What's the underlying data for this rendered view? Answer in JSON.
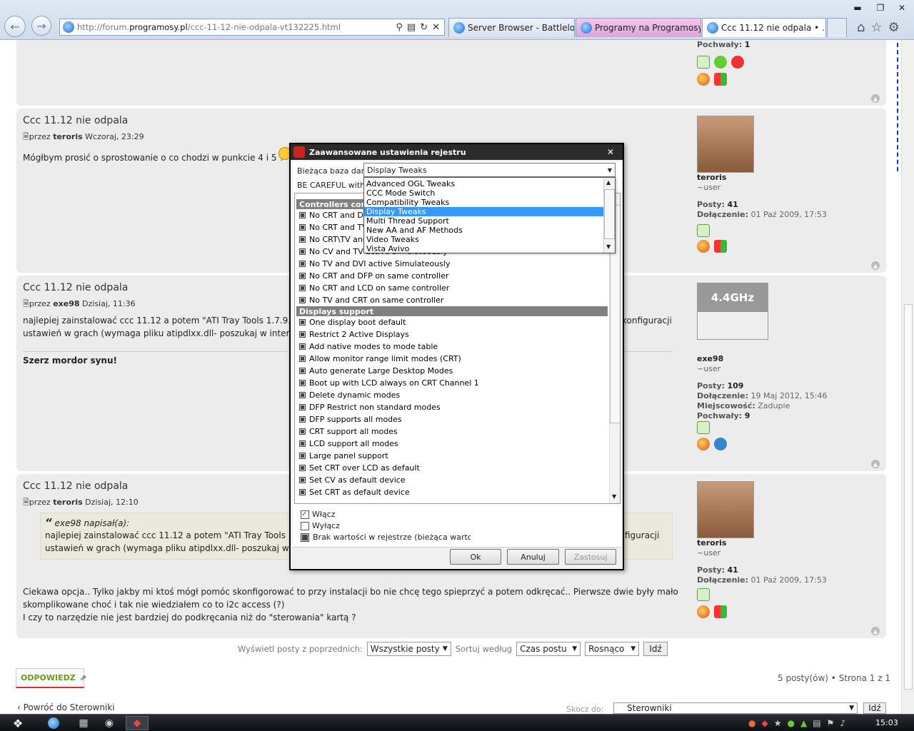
{
  "browser": {
    "address_prefix": "http://forum.",
    "address_domain": "programosy.pl",
    "address_suffix": "/ccc-11-12-nie-odpala-vt132225.html",
    "tabs": [
      {
        "label": "Server Browser - Battlelog ..."
      },
      {
        "label": "Programy na Programosy...."
      },
      {
        "label": "Ccc 11.12 nie odpala • ..."
      }
    ]
  },
  "top_profile": {
    "label": "Pochwały:",
    "value": "1"
  },
  "posts": [
    {
      "title": "Ccc 11.12 nie odpala",
      "meta_by": "przez",
      "author": "teroris",
      "time": "Wczoraj, 23:29",
      "text": "Mógłbym prosić o sprostowanie o co chodzi w punkcie 4 i 5 ?",
      "profile": {
        "name": "teroris",
        "rank": "~user",
        "posts_label": "Posty:",
        "posts": "41",
        "joined_label": "Dołączenie:",
        "joined": "01 Paź 2009, 17:53"
      }
    },
    {
      "title": "Ccc 11.12 nie odpala",
      "meta_by": "przez",
      "author": "exe98",
      "time": "Dzisiaj, 11:36",
      "text1": "najlepiej zainstalować ccc 11.12 a potem \"ATI Tray Tools 1.7.9.",
      "text1_end": "konfiguracji",
      "text2": "ustawień w grach (wymaga pliku atipdlxx.dll- poszukaj w intern",
      "signature": "Szerz mordor synu!",
      "avatar_text": "4.4GHz",
      "profile": {
        "name": "exe98",
        "rank": "~user",
        "posts_label": "Posty:",
        "posts": "109",
        "joined_label": "Dołączenie:",
        "joined": "19 Maj 2012, 15:46",
        "location_label": "Miejscowość:",
        "location": "Zadupie",
        "praise_label": "Pochwały:",
        "praise": "9"
      }
    },
    {
      "title": "Ccc 11.12 nie odpala",
      "meta_by": "przez",
      "author": "teroris",
      "time": "Dzisiaj, 12:10",
      "quote_author": "exe98 napisał(a):",
      "quote1": "najlepiej zainstalować ccc 11.12 a potem \"ATI Tray Tools 1.7.9",
      "quote1_end": "figuracji",
      "quote2": "ustawień w grach (wymaga pliku atipdlxx.dll- poszukaj w inter",
      "text1": "Ciekawa opcja.. Tylko jakby mi ktoś mógł pomóc skonfigorować to przy instalacji bo nie chcę tego spieprzyć a potem odkręcać.. Pierwsze dwie były mało",
      "text2": "skomplikowane choć i tak nie wiedziałem co to i2c access (?)",
      "text3": "I czy to narzędzie nie jest bardziej do podkręcania niż do \"sterowania\" kartą ?",
      "profile": {
        "name": "teroris",
        "rank": "~user",
        "posts_label": "Posty:",
        "posts": "41",
        "joined_label": "Dołączenie:",
        "joined": "01 Paź 2009, 17:53"
      }
    }
  ],
  "sortbar": {
    "show_label": "Wyświetl posty z poprzednich:",
    "show_value": "Wszystkie posty",
    "sort_label": "Sortuj według",
    "sort_value": "Czas postu",
    "order_value": "Rosnąco",
    "go": "Idź"
  },
  "footer": {
    "reply": "ODPOWIEDZ",
    "count": "5 posty(ów) • Strona 1 z 1",
    "back": "Powróć do Sterowniki",
    "jump_label": "Skocz do:",
    "jump_value": "Sterowniki",
    "go": "Idź"
  },
  "dialog": {
    "title": "Zaawansowane ustawienia rejestru",
    "db_label": "Bieżąca baza danyc",
    "db_value": "Display Tweaks",
    "warning": "BE CAREFUL with t",
    "dropdown": [
      "Advanced OGL Tweaks",
      "CCC Mode Switch",
      "Compatibility Tweaks",
      "Display Tweaks",
      "Multi Thread Support",
      "New AA and AF Methods",
      "Video Tweaks",
      "Vista Avivo"
    ],
    "group1": "Controllers confi",
    "group1_items": [
      "No CRT and DFP",
      "No CRT and TV a",
      "No CRT\\TV and D",
      "No CV and TV active Simulateously",
      "No TV and DVI active Simulateously",
      "No CRT and DFP on same controller",
      "No CRT and LCD on same controller",
      "No TV and CRT on same controller"
    ],
    "group2": "Displays support",
    "group2_items": [
      "One display boot default",
      "Restrict 2 Active Displays",
      "Add native modes to mode table",
      "Allow monitor range limit modes (CRT)",
      "Auto generate Large Desktop Modes",
      "Boot up with LCD always on CRT Channel 1",
      "Delete dynamic modes",
      "DFP Restrict non standard modes",
      "DFP supports all modes",
      "CRT support all modes",
      "LCD support all modes",
      "Large panel support",
      "Set CRT over LCD as default",
      "Set CV as default device",
      "Set CRT as default device"
    ],
    "opt_on": "Włącz",
    "opt_off": "Wyłącz",
    "opt_none": "Brak wartości w rejestrze (bieżąca wartość nie",
    "ok": "Ok",
    "cancel": "Anuluj",
    "apply": "Zastosuj"
  },
  "taskbar": {
    "clock": "15:03"
  }
}
